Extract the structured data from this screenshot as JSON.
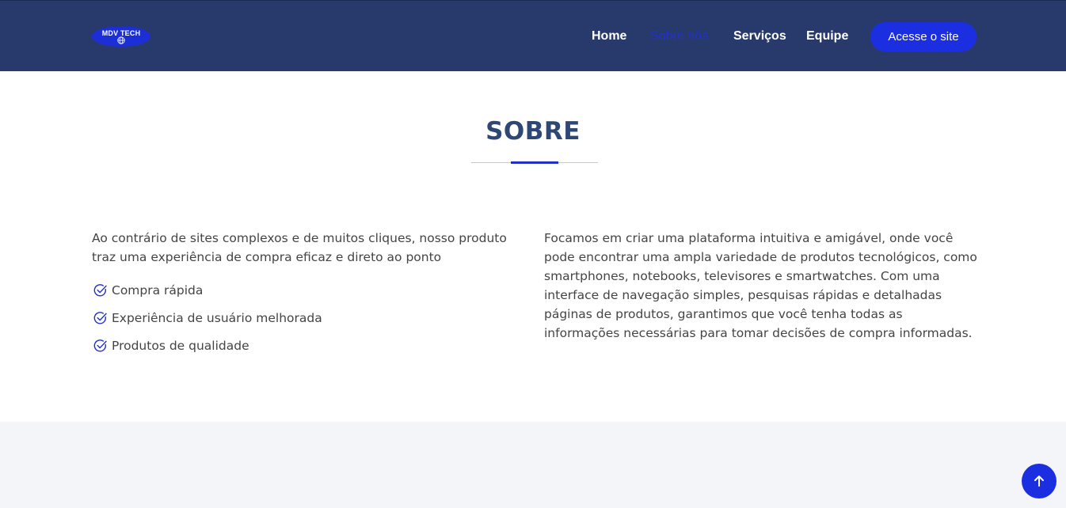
{
  "header": {
    "logo_text": "MDV TECH",
    "nav": [
      {
        "label": "Home"
      },
      {
        "label": "Sobre nós",
        "active": true
      },
      {
        "label": "Serviços"
      },
      {
        "label": "Equipe"
      }
    ],
    "cta_label": "Acesse o site"
  },
  "about": {
    "title": "SOBRE",
    "left_text": "Ao contrário de sites complexos e de muitos cliques, nosso produto traz uma experiência de compra eficaz e direto ao ponto",
    "features": [
      {
        "label": "Compra rápida",
        "icon": "check-circle-icon"
      },
      {
        "label": "Experiência de usuário melhorada",
        "icon": "check-circle-icon"
      },
      {
        "label": "Produtos de qualidade",
        "icon": "check-circle-icon"
      }
    ],
    "right_text": "Focamos em criar uma plataforma intuitiva e amigável, onde você pode encontrar uma ampla variedade de produtos tecnológicos, como smartphones, notebooks, televisores e smartwatches. Com uma interface de navegação simples, pesquisas rápidas e detalhadas páginas de produtos, garantimos que você tenha todas as informações necessárias para tomar decisões de compra informadas."
  },
  "back_to_top": {
    "icon": "arrow-up-icon"
  },
  "colors": {
    "header_bg": "#283a6c",
    "accent": "#1b2fe0",
    "title": "#2f4774",
    "text": "#444444",
    "section_bg": "#f3f5f9"
  }
}
